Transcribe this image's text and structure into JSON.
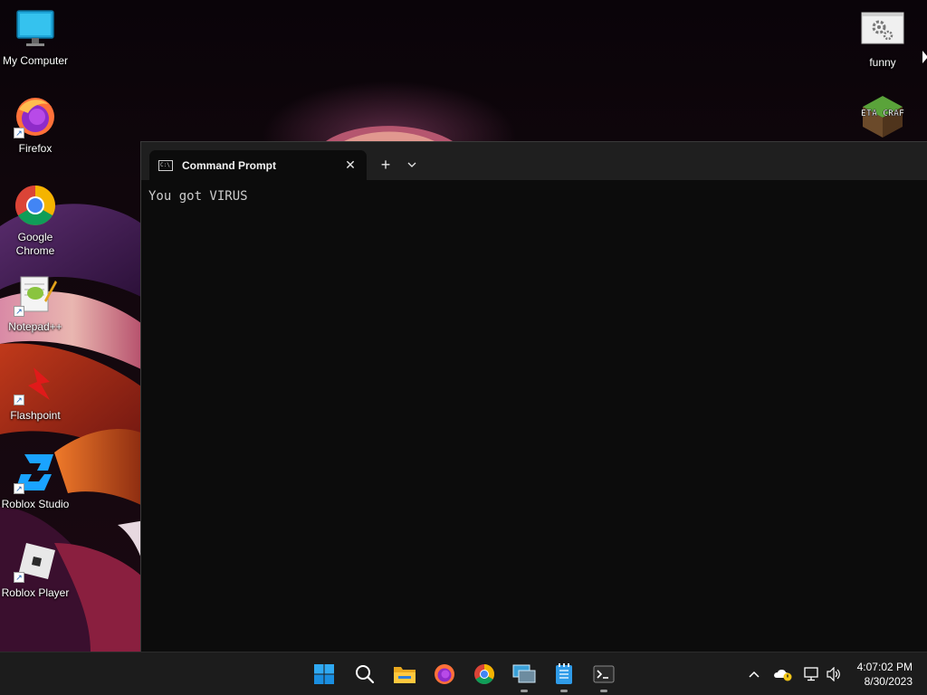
{
  "desktop": {
    "icons": [
      {
        "label": "My Computer",
        "icon": "monitor-icon"
      },
      {
        "label": "Firefox",
        "icon": "firefox-icon"
      },
      {
        "label": "Google Chrome",
        "icon": "chrome-icon"
      },
      {
        "label": "Notepad++",
        "icon": "notepad-plus-plus-icon"
      },
      {
        "label": "Flashpoint",
        "icon": "flashpoint-icon"
      },
      {
        "label": "Roblox Studio",
        "icon": "roblox-studio-icon"
      },
      {
        "label": "Roblox Player",
        "icon": "roblox-player-icon"
      },
      {
        "label": "funny",
        "icon": "settings-file-icon"
      },
      {
        "label": "",
        "icon": "betacraft-icon",
        "image_text": "BETA CRAFT"
      }
    ]
  },
  "terminal": {
    "tab_title": "Command Prompt",
    "tab_icon_text": "C:\\",
    "close_glyph": "✕",
    "new_tab_glyph": "+",
    "output": "You got VIRUS"
  },
  "taskbar": {
    "apps": [
      {
        "name": "start",
        "icon": "windows-start-icon",
        "running": false
      },
      {
        "name": "search",
        "icon": "search-icon",
        "running": false
      },
      {
        "name": "file-explorer",
        "icon": "folder-icon",
        "running": false
      },
      {
        "name": "firefox",
        "icon": "firefox-icon",
        "running": false
      },
      {
        "name": "chrome",
        "icon": "chrome-icon",
        "running": false
      },
      {
        "name": "virtual-machine",
        "icon": "vm-icon",
        "running": true
      },
      {
        "name": "notepad",
        "icon": "notepad-icon",
        "running": true
      },
      {
        "name": "terminal",
        "icon": "terminal-icon",
        "running": true
      }
    ],
    "tray": {
      "chevron": "^",
      "time": "4:07:02 PM",
      "date": "8/30/2023"
    }
  },
  "colors": {
    "terminal_bg": "#0c0c0c",
    "titlebar_bg": "#1f1f1f",
    "taskbar_bg": "#1c1c1c",
    "accent_blue": "#0078d4"
  }
}
